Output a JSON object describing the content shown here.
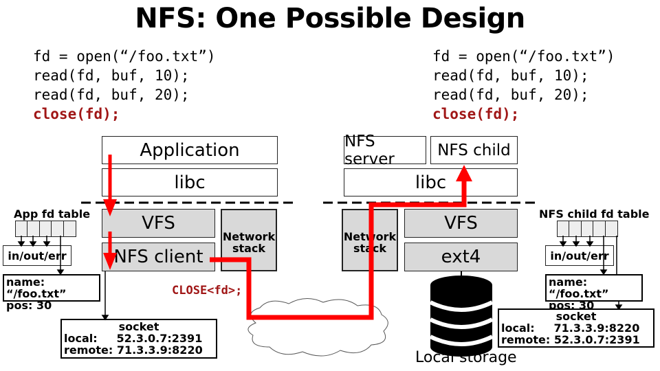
{
  "title": "NFS: One Possible Design",
  "client_code": [
    "fd = open(“/foo.txt”)",
    "read(fd, buf, 10);",
    "read(fd, buf, 20);",
    "close(fd);"
  ],
  "server_code": [
    "fd = open(“/foo.txt”)",
    "read(fd, buf, 10);",
    "read(fd, buf, 20);",
    "close(fd);"
  ],
  "client": {
    "application": "Application",
    "libc": "libc",
    "vfs": "VFS",
    "nfs_client": "NFS client",
    "network_stack": "Network stack",
    "fd_table_label": "App fd table",
    "stdio": "in/out/err",
    "file_name": "name: “/foo.txt”",
    "file_pos": "pos: 30",
    "socket_title": "socket",
    "socket_local": "local:     52.3.0.7:2391",
    "socket_remote": "remote: 71.3.3.9:8220"
  },
  "server": {
    "nfs_server": "NFS server",
    "nfs_child": "NFS child",
    "libc": "libc",
    "vfs": "VFS",
    "ext4": "ext4",
    "network_stack": "Network stack",
    "fd_table_label": "NFS child fd table",
    "stdio": "in/out/err",
    "file_name": "name: “/foo.txt”",
    "file_pos": "pos: 30",
    "socket_title": "socket",
    "socket_local": "local:     71.3.3.9:8220",
    "socket_remote": "remote: 52.3.0.7:2391",
    "storage_label": "Local storage"
  },
  "message": "CLOSE<fd>;",
  "network_label": "Network",
  "colors": {
    "arrow": "#ff0000",
    "message": "#a01616",
    "layer_fill": "#d9d9d9"
  }
}
